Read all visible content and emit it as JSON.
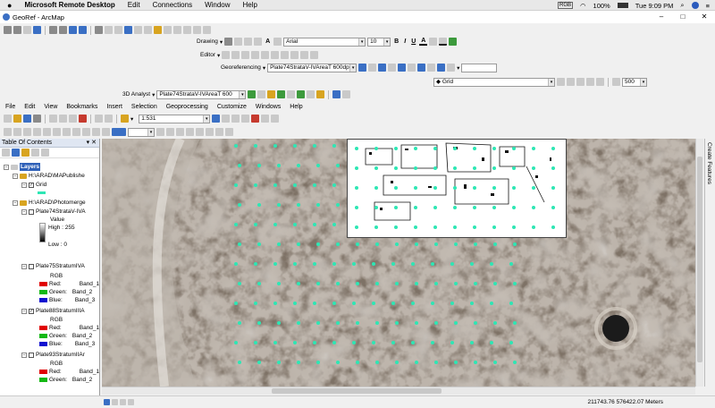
{
  "mac_menu": {
    "apple_icon": "apple-icon",
    "app_name": "Microsoft Remote Desktop",
    "items": [
      "Edit",
      "Connections",
      "Window",
      "Help"
    ],
    "battery": "100%",
    "clock": "Tue 9:09 PM"
  },
  "window": {
    "title": "GeoRef - ArcMap",
    "minimize": "–",
    "maximize": "□",
    "close": "✕"
  },
  "toolbars": {
    "drawing_label": "Drawing",
    "font_name": "Arial",
    "font_size": "10",
    "bold": "B",
    "italic": "I",
    "underline": "U",
    "text_tool": "A",
    "editor_label": "Editor",
    "georef_label": "Georeferencing",
    "georef_layer": "Plate74StrataV-IVAreaT 600dpi.tif",
    "analyst_label": "3D Analyst",
    "analyst_layer": "Plate74StrataV-IVAreaT 600",
    "grid_layer": "Grid",
    "grid_value": "500",
    "scale": "1:531"
  },
  "menubar": [
    "File",
    "Edit",
    "View",
    "Bookmarks",
    "Insert",
    "Selection",
    "Geoprocessing",
    "Customize",
    "Windows",
    "Help"
  ],
  "toc": {
    "title": "Table Of Contents",
    "pin": "▾ ✕",
    "layers_root": "Layers",
    "group1": "H:\\ARAD\\MAPublishe",
    "grid": "Grid",
    "group2": "H:\\ARAD\\Photomerge",
    "plate74": "Plate74StrataV-IVA",
    "value_label": "Value",
    "high": "High : 255",
    "low": "Low : 0",
    "plate75": "Plate75StratumIVA",
    "rgb": "RGB",
    "red": "Red:",
    "green": "Green:",
    "blue": "Blue:",
    "band1": "Band_1",
    "band2": "Band_2",
    "band3": "Band_3",
    "plate88": "Plate88StratumIIIA",
    "plate93": "Plate93StratumIIAr"
  },
  "side_panel": "Create Features",
  "status": {
    "coords": "211743.76  576422.07 Meters"
  },
  "colors": {
    "red_band": "#e00000",
    "green_band": "#14b814",
    "blue_band": "#1010d0",
    "grid_points": "#2ee6b4"
  }
}
